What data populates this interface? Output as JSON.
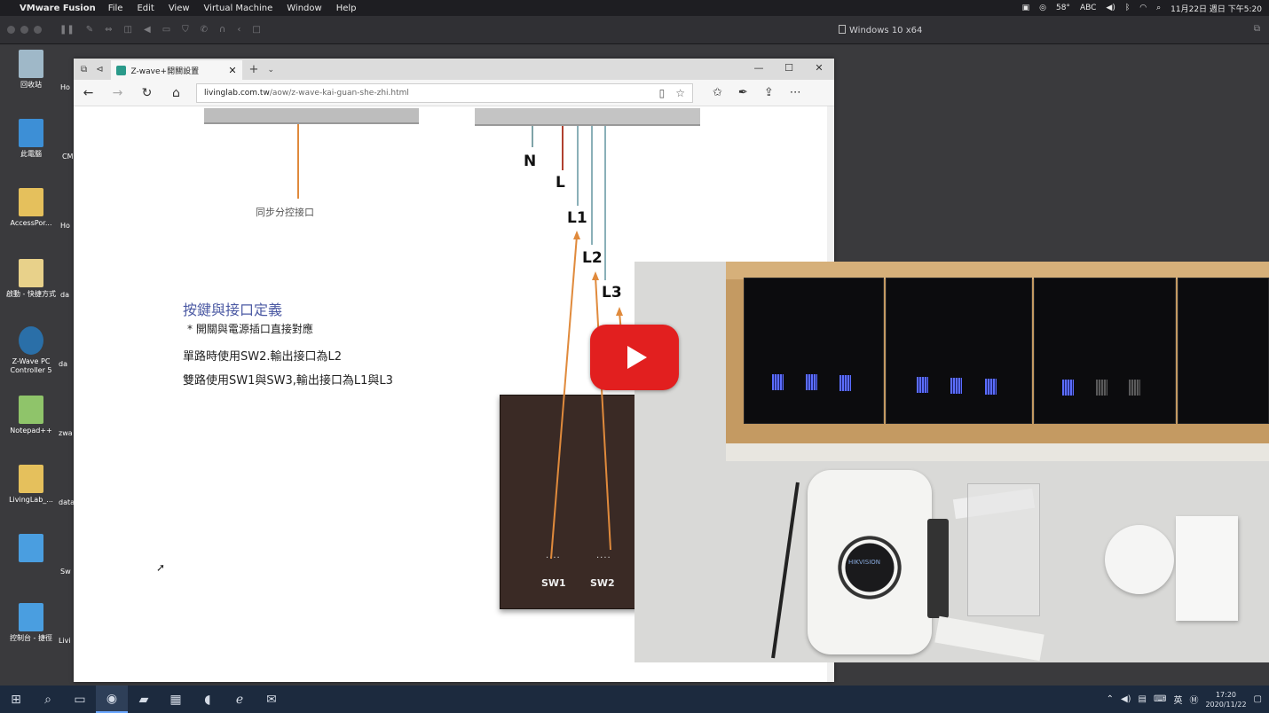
{
  "mac": {
    "app": "VMware Fusion",
    "menus": [
      "File",
      "Edit",
      "View",
      "Virtual Machine",
      "Window",
      "Help"
    ],
    "status": {
      "temp": "58°",
      "ime": "ABC",
      "clock": "11月22日 週日 下午5:20"
    }
  },
  "vm": {
    "title": "Windows 10 x64"
  },
  "desktop": {
    "icons": [
      "回收站",
      "此電腦",
      "AccessPor...",
      "啟動 - 快捷方式",
      "Z-Wave PC Controller 5",
      "Notepad++",
      "LivingLab_...",
      "",
      "控制台 - 捷徑"
    ],
    "partial": [
      "Ho",
      "CM",
      "Ho",
      "da",
      "da",
      "zwa",
      "data",
      "Sw",
      "Livi"
    ]
  },
  "browser": {
    "tab_title": "Z-wave+開關設置",
    "url_host": "livinglab.com.tw",
    "url_path": "/aow/z-wave-kai-guan-she-zhi.html"
  },
  "page": {
    "sync_label": "同步分控接口",
    "wires": {
      "n": "N",
      "l": "L",
      "l1": "L1",
      "l2": "L2",
      "l3": "L3"
    },
    "heading": "按鍵與接口定義",
    "note": "* 開關與電源插口直接對應",
    "single": "單路時使用SW2.輸出接口為L2",
    "double": "雙路使用SW1與SW3,輸出接口為L1與L3",
    "sw1": "SW1",
    "sw2": "SW2",
    "sw1_dots": "....",
    "sw2_dots": "...."
  },
  "video": {
    "hub_brand": "HIKVISION"
  },
  "taskbar": {
    "ime": "英",
    "time": "17:20",
    "date": "2020/11/22"
  }
}
